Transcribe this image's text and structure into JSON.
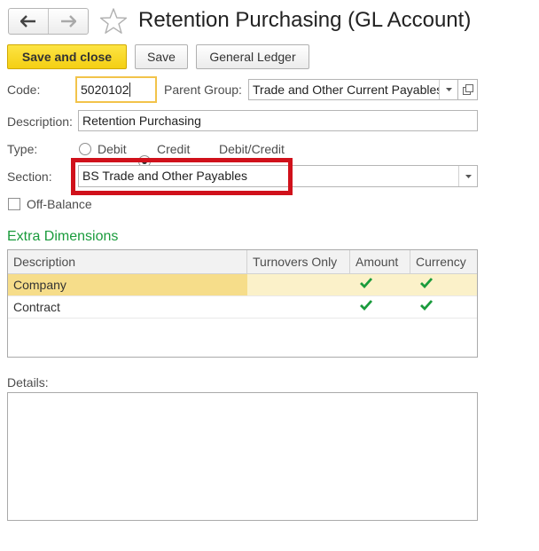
{
  "header": {
    "title": "Retention Purchasing (GL Account)"
  },
  "toolbar": {
    "save_and_close": "Save and close",
    "save": "Save",
    "general_ledger": "General Ledger"
  },
  "form": {
    "code_label": "Code:",
    "code_value": "5020102",
    "parent_group_label": "Parent Group:",
    "parent_group_value": "Trade and Other Current Payables",
    "description_label": "Description:",
    "description_value": "Retention Purchasing",
    "type_label": "Type:",
    "type_options": [
      "Debit",
      "Credit",
      "Debit/Credit"
    ],
    "type_selected": "Credit",
    "section_label": "Section:",
    "section_value": "BS Trade and Other Payables",
    "off_balance_label": "Off-Balance",
    "off_balance_checked": false
  },
  "extra_dimensions": {
    "title": "Extra Dimensions",
    "columns": [
      "Description",
      "Turnovers Only",
      "Amount",
      "Currency"
    ],
    "rows": [
      {
        "description": "Company",
        "turnovers_only": false,
        "amount": true,
        "currency": true
      },
      {
        "description": "Contract",
        "turnovers_only": false,
        "amount": true,
        "currency": true
      }
    ]
  },
  "details": {
    "label": "Details:",
    "value": ""
  },
  "colors": {
    "primary_button": "#f4cf13",
    "section_title": "#1a9b3c",
    "check": "#1a9b3c",
    "highlight_box": "#d0111b",
    "selected_row": "#fbf1c9"
  },
  "icons": [
    "back-arrow-icon",
    "forward-arrow-icon",
    "star-icon",
    "chevron-down-icon",
    "open-form-icon",
    "checkmark-icon"
  ]
}
